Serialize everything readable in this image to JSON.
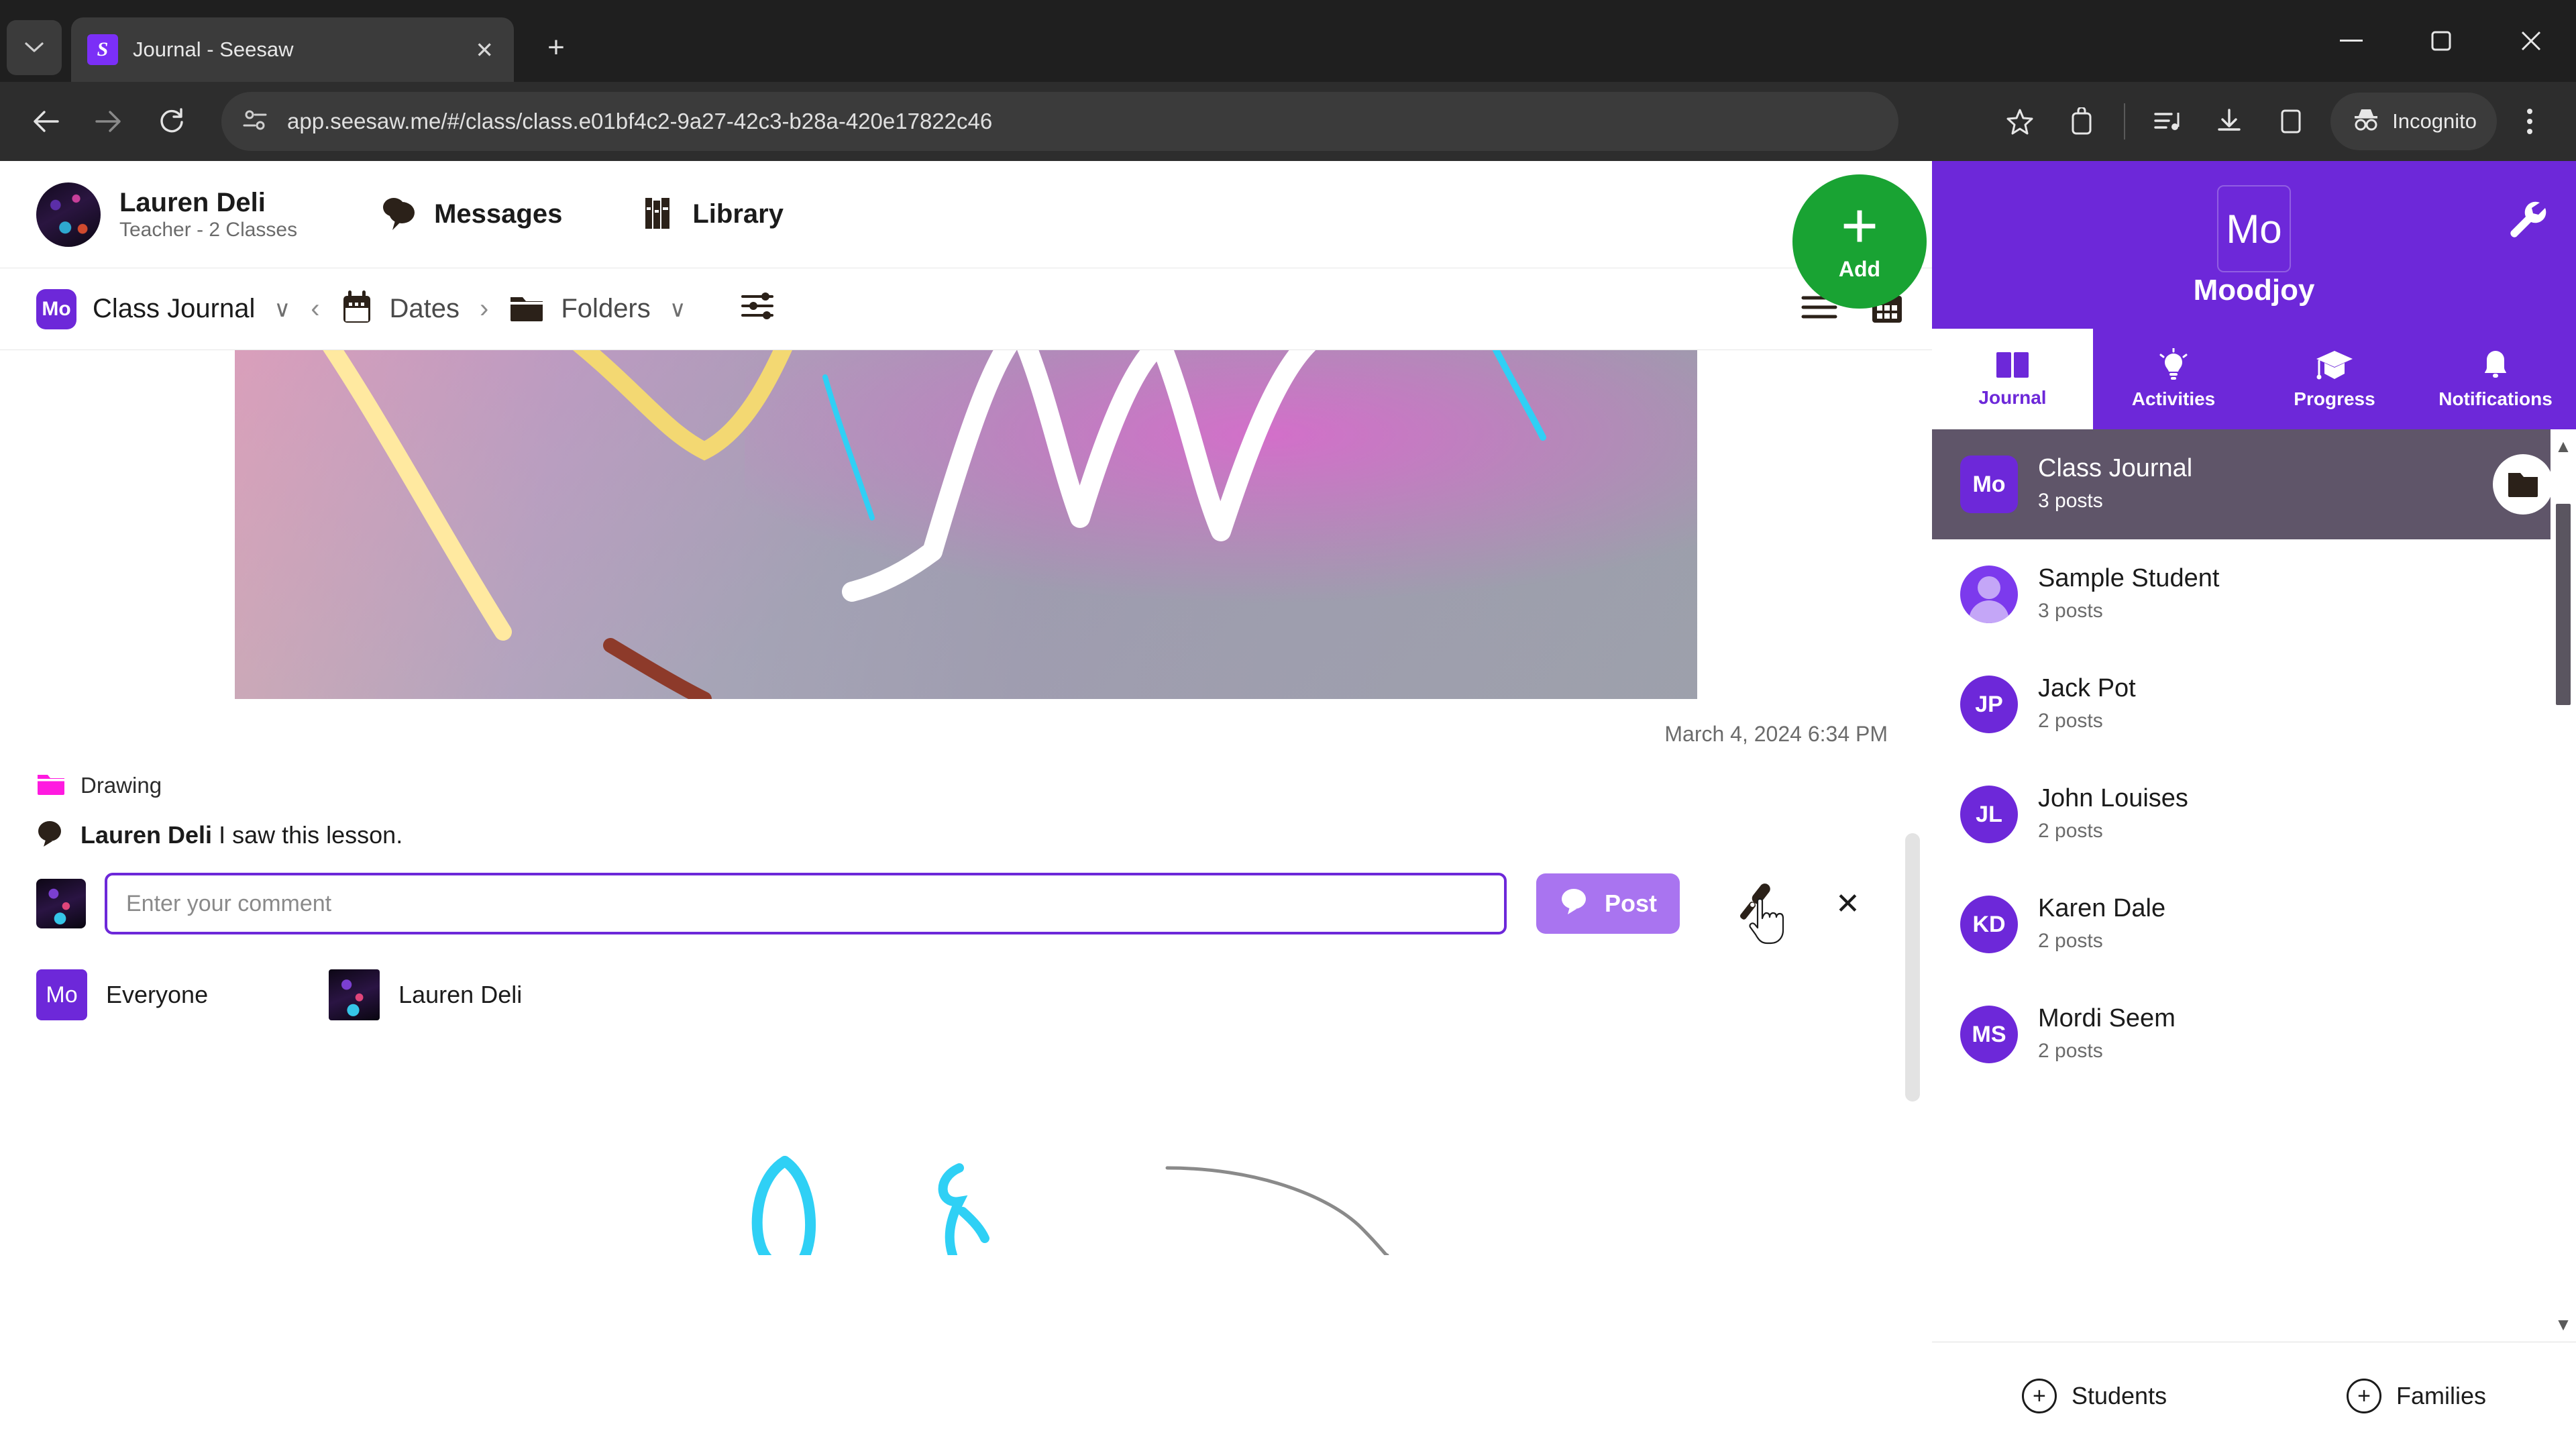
{
  "browser": {
    "tab": {
      "title": "Journal - Seesaw",
      "favicon_letter": "S"
    },
    "new_tab_label": "+",
    "tab_search_label": "v",
    "window": {
      "minimize": "–",
      "maximize": "□",
      "close": "✕"
    },
    "nav": {
      "back": "←",
      "forward": "→",
      "reload": "⟳"
    },
    "url": "app.seesaw.me/#/class/class.e01bf4c2-9a27-42c3-b28a-420e17822c46",
    "incognito_label": "Incognito",
    "icons": {
      "site_settings": "tune-icon",
      "bookmark": "star-icon",
      "extensions": "extensions-icon",
      "reading_list": "reading-list-icon",
      "downloads": "download-icon",
      "side_panel": "side-panel-icon",
      "incognito": "incognito-icon",
      "menu": "kebab-menu-icon"
    }
  },
  "app_header": {
    "user_name": "Lauren Deli",
    "user_role": "Teacher - 2 Classes",
    "messages_label": "Messages",
    "library_label": "Library"
  },
  "toolbar": {
    "class_badge": "Mo",
    "class_name": "Class Journal",
    "dates_label": "Dates",
    "folders_label": "Folders",
    "prev_arrow": "‹",
    "next_arrow": "›",
    "caret": "∨",
    "filter_icon": "filters-icon",
    "list_view_icon": "list-view-icon",
    "calendar_view_icon": "calendar-view-icon"
  },
  "post": {
    "timestamp": "March 4, 2024 6:34 PM",
    "folder_label": "Drawing",
    "folder_color": "#ff1ae0",
    "comment_author": "Lauren Deli",
    "comment_body": "I saw this lesson.",
    "compose_placeholder": "Enter your comment",
    "compose_value": "",
    "post_button_label": "Post",
    "post_button_color": "#a974f0",
    "mic_icon": "microphone-icon",
    "close_icon": "✕",
    "share_everyone_badge": "Mo",
    "share_everyone_label": "Everyone",
    "share_teacher_label": "Lauren Deli"
  },
  "sidebar": {
    "class_badge": "Mo",
    "class_name": "Moodjoy",
    "settings_icon": "wrench-icon",
    "add_button": {
      "label": "Add",
      "plus": "+",
      "color": "#19a333"
    },
    "tabs": [
      {
        "label": "Journal",
        "icon": "book-icon",
        "active": true
      },
      {
        "label": "Activities",
        "icon": "lightbulb-icon",
        "active": false
      },
      {
        "label": "Progress",
        "icon": "graduation-cap-icon",
        "active": false
      },
      {
        "label": "Notifications",
        "icon": "bell-icon",
        "active": false
      }
    ],
    "rows": [
      {
        "initials": "Mo",
        "name": "Class Journal",
        "sub": "3 posts",
        "active": true,
        "type": "class"
      },
      {
        "initials": "",
        "name": "Sample Student",
        "sub": "3 posts",
        "active": false,
        "type": "person"
      },
      {
        "initials": "JP",
        "name": "Jack Pot",
        "sub": "2 posts",
        "active": false,
        "type": "student"
      },
      {
        "initials": "JL",
        "name": "John Louises",
        "sub": "2 posts",
        "active": false,
        "type": "student"
      },
      {
        "initials": "KD",
        "name": "Karen Dale",
        "sub": "2 posts",
        "active": false,
        "type": "student"
      },
      {
        "initials": "MS",
        "name": "Mordi Seem",
        "sub": "2 posts",
        "active": false,
        "type": "student"
      }
    ],
    "bottom": {
      "students_label": "Students",
      "families_label": "Families",
      "plus": "+"
    },
    "scroll_up": "▲",
    "scroll_down": "▼",
    "accent_color": "#6d28d9"
  }
}
